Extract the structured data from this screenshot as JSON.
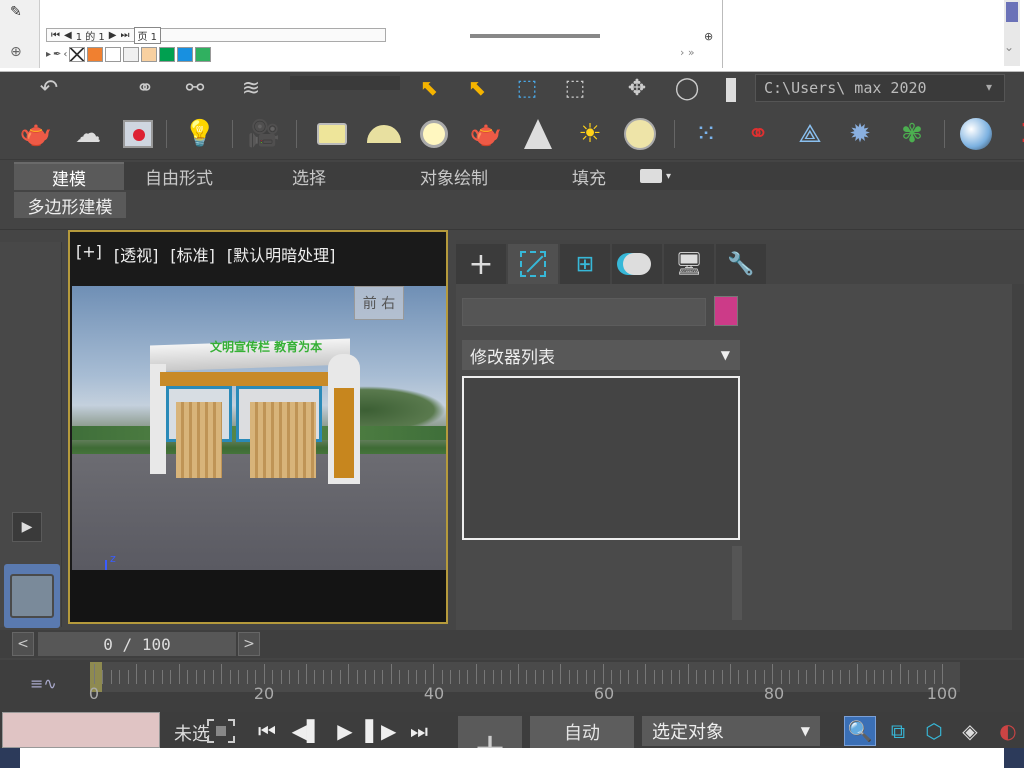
{
  "doc_strip": {
    "page_prefix": "1 的 1",
    "page_label": "页 1",
    "palette_colors": [
      "#ffffff",
      "#f08030",
      "#ffffff",
      "#f0f0f0",
      "#f8d0a0",
      "#00a050",
      "#1890e0",
      "#30b060"
    ],
    "scroll_chevrons": "› »"
  },
  "toolbar": {
    "path_text": "C:\\Users\\   max 2020"
  },
  "ribbon": {
    "tabs": [
      "建模",
      "自由形式",
      "选择",
      "对象绘制",
      "填充"
    ],
    "active_tab": "建模",
    "subtab": "多边形建模"
  },
  "viewport": {
    "labels": [
      "[+]",
      "[透视]",
      "[标准]",
      "[默认明暗处理]"
    ],
    "viewcube_text": "前 右",
    "model_title": "文明宣传栏 教育为本",
    "axis_labels": {
      "z": "z",
      "x": "x",
      "y": "y"
    }
  },
  "command_panel": {
    "tabs": [
      "create",
      "modify",
      "hierarchy",
      "motion",
      "display",
      "utilities"
    ],
    "active_tab": "modify",
    "object_color": "#cc3b88",
    "modifier_list_label": "修改器列表"
  },
  "time_slider": {
    "frame_text": "0 / 100",
    "prev": "<",
    "next": ">"
  },
  "track_bar": {
    "ticks": [
      "0",
      "20",
      "40",
      "60",
      "80",
      "100"
    ]
  },
  "status": {
    "text": "未选",
    "auto_label": "自动",
    "selection_dropdown": "选定对象"
  }
}
